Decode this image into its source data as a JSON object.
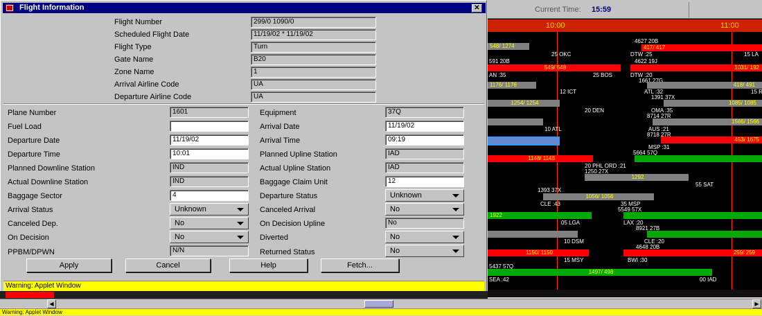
{
  "dialog": {
    "title": "Flight Information",
    "close_glyph": "✕",
    "icon": "app-icon"
  },
  "top_fields": [
    {
      "label": "Flight Number",
      "value": "299/0 1090/0"
    },
    {
      "label": "Scheduled Flight Date",
      "value": "11/19/02 * 11/19/02"
    },
    {
      "label": "Flight Type",
      "value": "Turn"
    },
    {
      "label": "Gate Name",
      "value": "B20"
    },
    {
      "label": "Zone Name",
      "value": "1"
    },
    {
      "label": "Arrival Airline Code",
      "value": "UA"
    },
    {
      "label": "Departure Airline Code",
      "value": "UA"
    }
  ],
  "left_fields": [
    {
      "label": "Plane Number",
      "value": "1601",
      "kind": "ro"
    },
    {
      "label": "Fuel Load",
      "value": "",
      "kind": "ed"
    },
    {
      "label": "Departure Date",
      "value": "11/19/02",
      "kind": "ed"
    },
    {
      "label": "Departure Time",
      "value": "10:01",
      "kind": "ed"
    },
    {
      "label": "Planned Downline Station",
      "value": "IND",
      "kind": "ro"
    },
    {
      "label": "Actual Downline Station",
      "value": "IND",
      "kind": "ro"
    },
    {
      "label": "Baggage Sector",
      "value": "4",
      "kind": "ed"
    },
    {
      "label": "Arrival Status",
      "value": "Unknown",
      "kind": "combo"
    },
    {
      "label": "Canceled Dep.",
      "value": "No",
      "kind": "combo"
    },
    {
      "label": "On Decision",
      "value": "No",
      "kind": "combo"
    },
    {
      "label": "PPBM/DPWN",
      "value": "N/N",
      "kind": "ro"
    }
  ],
  "right_fields": [
    {
      "label": "Equipment",
      "value": "37Q",
      "kind": "ro"
    },
    {
      "label": "Arrival Date",
      "value": "11/19/02",
      "kind": "ed"
    },
    {
      "label": "Arrival Time",
      "value": "09:19",
      "kind": "ed"
    },
    {
      "label": "Planned Upline Station",
      "value": "IAD",
      "kind": "ro"
    },
    {
      "label": "Actual Upline Station",
      "value": "IAD",
      "kind": "ro"
    },
    {
      "label": "Baggage Claim Unit",
      "value": "12",
      "kind": "ed"
    },
    {
      "label": "Departure Status",
      "value": "Unknown",
      "kind": "combo"
    },
    {
      "label": "Canceled Arrival",
      "value": "No",
      "kind": "combo"
    },
    {
      "label": "On Decision Upline",
      "value": "No",
      "kind": "ro"
    },
    {
      "label": "Diverted",
      "value": "No",
      "kind": "combo"
    },
    {
      "label": "Returned Status",
      "value": "No",
      "kind": "combo"
    }
  ],
  "buttons": {
    "apply": "Apply",
    "cancel": "Cancel",
    "help": "Help",
    "fetch": "Fetch..."
  },
  "warning": "Warning: Applet Window",
  "warning_bottom": "Warning: Applet Window",
  "gantt": {
    "current_time_label": "Current Time:",
    "current_time": "15:59",
    "hour_1": "10:00",
    "hour_2": "11:00",
    "bars": [
      {
        "label": "548/ 1274",
        "color": "#808080"
      },
      {
        "label": "4627 20B",
        "color": "text"
      },
      {
        "label": "417/ 417",
        "color": "#ff0000"
      },
      {
        "label": "25 OKC",
        "color": "text"
      },
      {
        "label": "DTW :25",
        "color": "text"
      },
      {
        "label": "15 LA",
        "color": "text"
      },
      {
        "label": "591 20B",
        "color": "text"
      },
      {
        "label": "4622 19J",
        "color": "text"
      },
      {
        "label": "549/ 548",
        "color": "#ff0000"
      },
      {
        "label": "1031/ 192",
        "color": "#ff0000"
      },
      {
        "label": "AN :35",
        "color": "text"
      },
      {
        "label": "25 BOS",
        "color": "text"
      },
      {
        "label": "DTW :20",
        "color": "text"
      },
      {
        "label": "1661 27G",
        "color": "text"
      },
      {
        "label": "1176/ 1176",
        "color": "#808080"
      },
      {
        "label": "418/ 491",
        "color": "#808080"
      },
      {
        "label": "12 ICT",
        "color": "text"
      },
      {
        "label": "ATL :32",
        "color": "text"
      },
      {
        "label": "15 R",
        "color": "text"
      },
      {
        "label": "1391 37X",
        "color": "text"
      },
      {
        "label": "1254/ 1254",
        "color": "#808080"
      },
      {
        "label": "1085/ 1085",
        "color": "#808080"
      },
      {
        "label": "20 DEN",
        "color": "text"
      },
      {
        "label": "OMA :35",
        "color": "text"
      },
      {
        "label": "8714 27R",
        "color": "text"
      },
      {
        "label": "1566/ 1566",
        "color": "#808080"
      },
      {
        "label": "10 ATL",
        "color": "text"
      },
      {
        "label": "AUS :21",
        "color": "text"
      },
      {
        "label": "8718 27R",
        "color": "text"
      },
      {
        "label": "453/ 1675",
        "color": "#ff0000"
      },
      {
        "label": "MSP :31",
        "color": "text"
      },
      {
        "label": "5664 57Q",
        "color": "text"
      },
      {
        "label": "1148/ 1148",
        "color": "#ff0000"
      },
      {
        "label": "20 PHL ORD :21",
        "color": "text"
      },
      {
        "label": "1250 27X",
        "color": "text"
      },
      {
        "label": "1292",
        "color": "#808080"
      },
      {
        "label": "55 SAT",
        "color": "text"
      },
      {
        "label": "1393 37X",
        "color": "text"
      },
      {
        "label": "1056/ 1056",
        "color": "#808080"
      },
      {
        "label": "CLE :43",
        "color": "text"
      },
      {
        "label": "35 MSP",
        "color": "text"
      },
      {
        "label": "5549 57X",
        "color": "text"
      },
      {
        "label": "1922",
        "color": "#00aa00"
      },
      {
        "label": "05 LGA",
        "color": "text"
      },
      {
        "label": "LAX :20",
        "color": "text"
      },
      {
        "label": "8921 27B",
        "color": "text"
      },
      {
        "label": "10 DSM",
        "color": "text"
      },
      {
        "label": "CLE :20",
        "color": "text"
      },
      {
        "label": "4648 20B",
        "color": "text"
      },
      {
        "label": "1150/ 1150",
        "color": "#ff0000"
      },
      {
        "label": "259/ 259",
        "color": "#ff0000"
      },
      {
        "label": "15 MSY",
        "color": "text"
      },
      {
        "label": "BWI :30",
        "color": "text"
      },
      {
        "label": "5437 57Q",
        "color": "text"
      },
      {
        "label": "1497/ 498",
        "color": "#00aa00"
      },
      {
        "label": "SEA :42",
        "color": "text"
      },
      {
        "label": "00 IAD",
        "color": "text"
      }
    ]
  }
}
